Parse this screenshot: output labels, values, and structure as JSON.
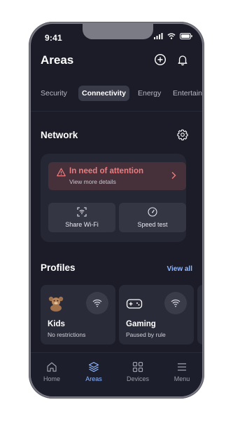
{
  "status_bar": {
    "time": "9:41"
  },
  "header": {
    "title": "Areas"
  },
  "tabs": [
    {
      "label": "Security",
      "active": false
    },
    {
      "label": "Connectivity",
      "active": true
    },
    {
      "label": "Energy",
      "active": false
    },
    {
      "label": "Entertain",
      "active": false
    }
  ],
  "network": {
    "title": "Network",
    "alert": {
      "title": "In need of attention",
      "subtitle": "View more details",
      "color": "#f07b7e"
    },
    "actions": [
      {
        "label": "Share Wi-Fi",
        "icon": "share-wifi-icon"
      },
      {
        "label": "Speed test",
        "icon": "speedometer-icon"
      }
    ]
  },
  "profiles": {
    "title": "Profiles",
    "view_all": "View all",
    "cards": [
      {
        "name": "Kids",
        "status": "No restrictions",
        "icon": "teddy-bear-icon"
      },
      {
        "name": "Gaming",
        "status": "Paused by rule",
        "icon": "gamepad-icon"
      }
    ]
  },
  "bottom_nav": [
    {
      "label": "Home",
      "icon": "home-icon",
      "active": false
    },
    {
      "label": "Areas",
      "icon": "layers-icon",
      "active": true
    },
    {
      "label": "Devices",
      "icon": "grid-icon",
      "active": false
    },
    {
      "label": "Menu",
      "icon": "menu-icon",
      "active": false
    }
  ],
  "colors": {
    "background": "#1b1c28",
    "card": "#262734",
    "accent": "#8fb8ff",
    "alert": "#f07b7e"
  }
}
